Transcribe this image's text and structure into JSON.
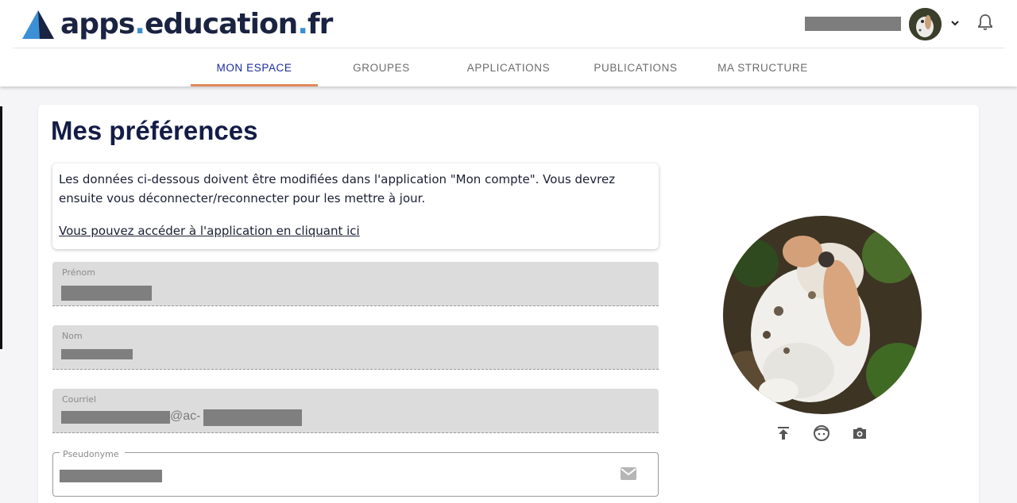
{
  "brand": {
    "part1": "apps",
    "part2": "education",
    "part3": "fr"
  },
  "user": {
    "avatar": "user-avatar-rabbit",
    "menu_icon": "chevron-down-icon",
    "notifications_icon": "bell-icon"
  },
  "nav": {
    "tabs": [
      {
        "label": "MON ESPACE",
        "active": true
      },
      {
        "label": "GROUPES",
        "active": false
      },
      {
        "label": "APPLICATIONS",
        "active": false
      },
      {
        "label": "PUBLICATIONS",
        "active": false
      },
      {
        "label": "MA STRUCTURE",
        "active": false
      }
    ]
  },
  "page": {
    "title": "Mes préférences"
  },
  "info": {
    "text": "Les données ci-dessous doivent être modifiées dans l'application \"Mon compte\". Vous devrez ensuite vous déconnecter/reconnecter pour les mettre à jour.",
    "link": "Vous pouvez accéder à l'application en cliquant ici"
  },
  "fields": {
    "firstname_label": "Prénom",
    "lastname_label": "Nom",
    "email_label": "Courriel",
    "email_visible_part": "@ac-",
    "nickname_label": "Pseudonyme"
  },
  "avatar_tools": {
    "upload_icon": "upload-icon",
    "face_icon": "face-icon",
    "camera_icon": "camera-icon"
  },
  "colors": {
    "brand_dark": "#1a2341",
    "brand_blue": "#3b90d6",
    "nav_active": "#1a2ca0",
    "nav_underline": "#e0895a",
    "field_bg": "#dcdcdc"
  }
}
